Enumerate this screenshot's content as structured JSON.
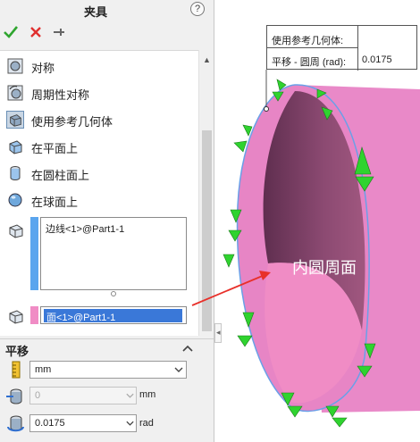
{
  "panel": {
    "title": "夹具",
    "help": "?",
    "options": [
      {
        "label": "对称",
        "icon": "symmetric-icon",
        "selected": false
      },
      {
        "label": "周期性对称",
        "icon": "cyclic-symmetry-icon",
        "selected": false
      },
      {
        "label": "使用参考几何体",
        "icon": "reference-geometry-icon",
        "selected": true
      },
      {
        "label": "在平面上",
        "icon": "on-flat-face-icon",
        "selected": false
      },
      {
        "label": "在圆柱面上",
        "icon": "on-cylindrical-face-icon",
        "selected": false
      },
      {
        "label": "在球面上",
        "icon": "on-spherical-face-icon",
        "selected": false
      }
    ],
    "selection_faces": "边线<1>@Part1-1",
    "selection_reference": "面<1>@Part1-1"
  },
  "translation": {
    "title": "平移",
    "unit": "mm",
    "distance_value": "0",
    "distance_unit": "mm",
    "angle_value": "0.0175",
    "angle_unit": "rad"
  },
  "viewport": {
    "callout_title": "使用参考几何体:",
    "callout_label": "平移 - 圆周 (rad):",
    "callout_value": "0.0175",
    "face_annotation": "内圆周面"
  },
  "colors": {
    "accept": "#2fa52f",
    "cancel": "#e0302f",
    "faces_strip": "#5aa5ee",
    "reference_strip": "#f08cc5",
    "selected_text_bg": "#3a78d8",
    "cylinder_outer": "#e989c8",
    "cylinder_inner": "#8c4a72",
    "fixture_arrows": "#2fd32f",
    "annotation_arrow": "#e8302a"
  }
}
